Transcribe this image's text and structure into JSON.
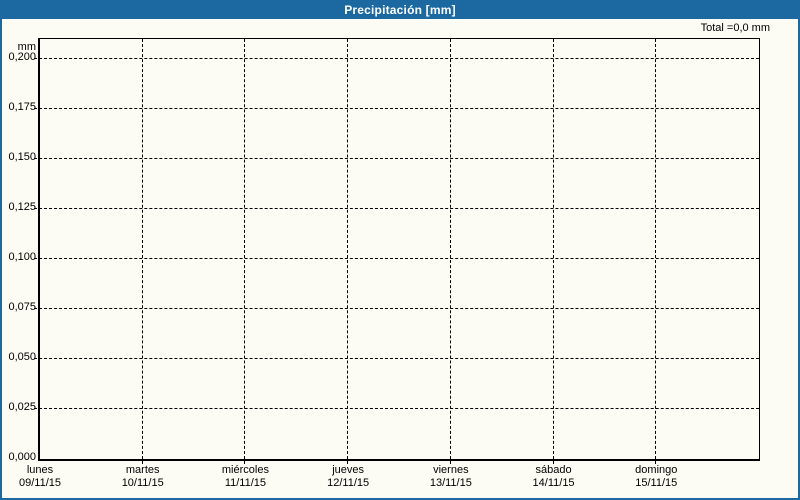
{
  "window": {
    "title": "Precipitación [mm]"
  },
  "summary": {
    "total": "Total =0,0 mm"
  },
  "chart_data": {
    "type": "line",
    "title": "Precipitación [mm]",
    "ylabel": "mm",
    "xlabel": "",
    "ylim": [
      0,
      0.21
    ],
    "y_ticks": [
      "0,200",
      "0,175",
      "0,150",
      "0,125",
      "0,100",
      "0,075",
      "0,050",
      "0,025",
      "0,000"
    ],
    "y_tick_values": [
      0.2,
      0.175,
      0.15,
      0.125,
      0.1,
      0.075,
      0.05,
      0.025,
      0.0
    ],
    "categories": [
      {
        "day": "lunes",
        "date": "09/11/15"
      },
      {
        "day": "martes",
        "date": "10/11/15"
      },
      {
        "day": "miércoles",
        "date": "11/11/15"
      },
      {
        "day": "jueves",
        "date": "12/11/15"
      },
      {
        "day": "viernes",
        "date": "13/11/15"
      },
      {
        "day": "sábado",
        "date": "14/11/15"
      },
      {
        "day": "domingo",
        "date": "15/11/15"
      }
    ],
    "series": [
      {
        "name": "Precipitación",
        "values": [
          0,
          0,
          0,
          0,
          0,
          0,
          0
        ]
      }
    ],
    "total_label": "Total =0,0 mm",
    "grid": true,
    "legend_position": "none"
  },
  "colors": {
    "titlebar": "#1b69a0",
    "frame": "#1b69a0",
    "background": "#fcfcf4",
    "grid": "#000000",
    "text": "#000000",
    "title_text": "#ffffff"
  }
}
